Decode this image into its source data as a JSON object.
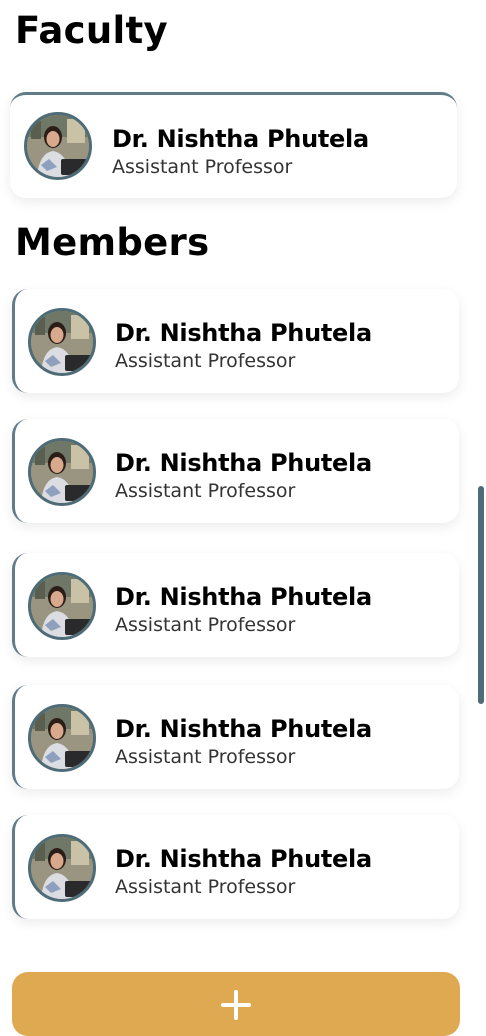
{
  "faculty": {
    "title": "Faculty",
    "person": {
      "name": "Dr. Nishtha Phutela",
      "role": "Assistant Professor"
    }
  },
  "members": {
    "title": "Members",
    "items": [
      {
        "name": "Dr. Nishtha Phutela",
        "role": "Assistant Professor"
      },
      {
        "name": "Dr. Nishtha Phutela",
        "role": "Assistant Professor"
      },
      {
        "name": "Dr. Nishtha Phutela",
        "role": "Assistant Professor"
      },
      {
        "name": "Dr. Nishtha Phutela",
        "role": "Assistant Professor"
      },
      {
        "name": "Dr. Nishtha Phutela",
        "role": "Assistant Professor"
      }
    ]
  },
  "actions": {
    "add_icon": "plus-icon"
  },
  "colors": {
    "accent": "#607c87",
    "add_button": "#dfa951"
  }
}
